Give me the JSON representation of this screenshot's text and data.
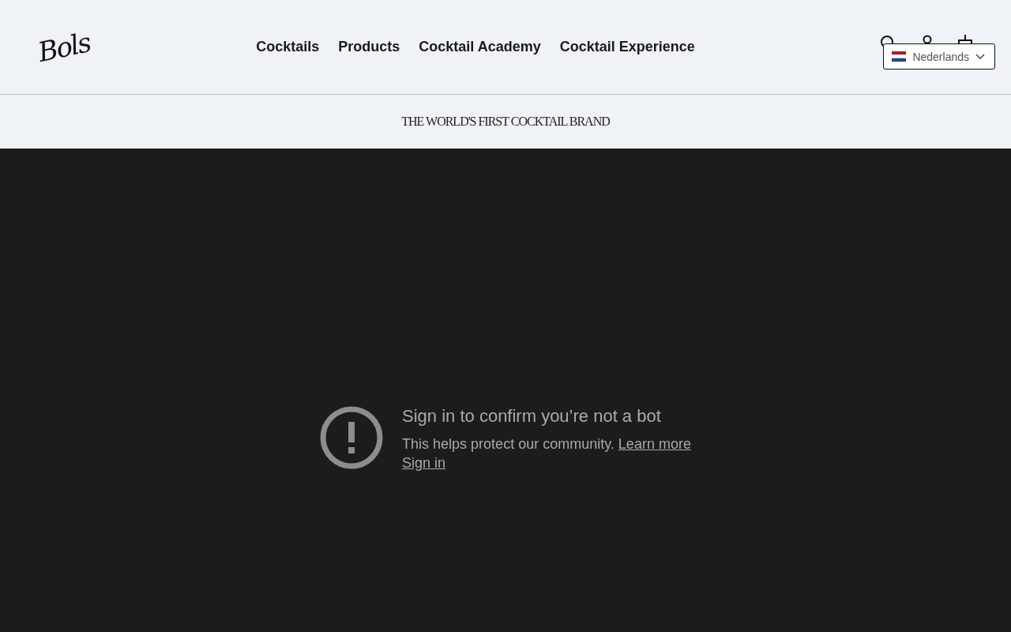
{
  "header": {
    "logo": "Bols",
    "nav": [
      "Cocktails",
      "Products",
      "Cocktail Academy",
      "Cocktail Experience"
    ],
    "language": "Nederlands"
  },
  "tagline": "THE WORLD'S FIRST COCKTAIL BRAND",
  "embed": {
    "title": "Sign in to confirm you’re not a bot",
    "message": "This helps protect our community.",
    "learn_more": "Learn more",
    "sign_in": "Sign in"
  }
}
